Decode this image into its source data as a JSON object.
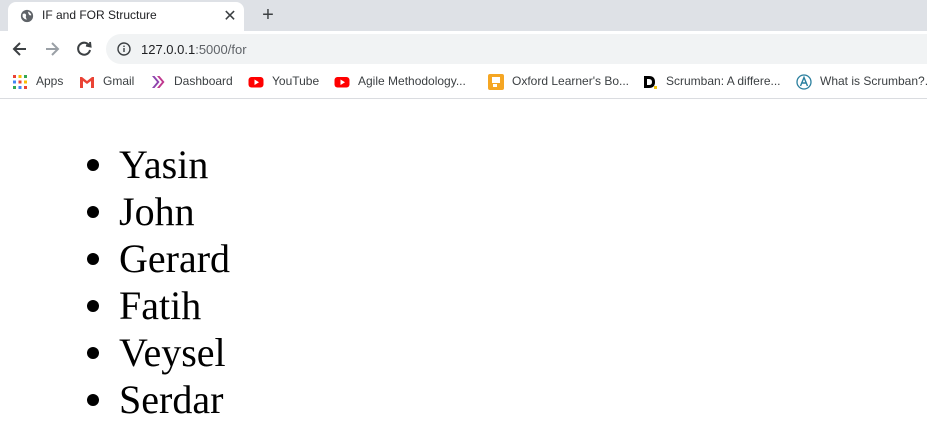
{
  "tab": {
    "title": "IF and FOR Structure",
    "favicon": "globe-icon",
    "close_icon": "close-icon",
    "new_tab_icon": "plus-icon"
  },
  "toolbar": {
    "back_icon": "arrow-left-icon",
    "forward_icon": "arrow-right-icon",
    "reload_icon": "reload-icon",
    "info_icon": "info-icon",
    "url_host": "127.0.0.1",
    "url_path": ":5000/for"
  },
  "bookmarks": [
    {
      "label": "Apps",
      "icon": "apps-grid-icon"
    },
    {
      "label": "Gmail",
      "icon": "gmail-icon"
    },
    {
      "label": "Dashboard",
      "icon": "dashboard-chevrons-icon"
    },
    {
      "label": "YouTube",
      "icon": "youtube-icon"
    },
    {
      "label": "Agile Methodology...",
      "icon": "youtube-icon"
    },
    {
      "label": "Oxford Learner's Bo...",
      "icon": "oxford-icon"
    },
    {
      "label": "Scrumban: A differe...",
      "icon": "d-logo-icon"
    },
    {
      "label": "What is Scrumban?...",
      "icon": "a-logo-icon"
    }
  ],
  "content": {
    "names": [
      "Yasin",
      "John",
      "Gerard",
      "Fatih",
      "Veysel",
      "Serdar"
    ]
  },
  "colors": {
    "tabstrip_bg": "#dee1e6",
    "omnibox_bg": "#f1f3f4",
    "text": "#202124",
    "youtube_red": "#ff0000",
    "gmail_red": "#ea4335",
    "oxford_yellow": "#f5a623"
  }
}
